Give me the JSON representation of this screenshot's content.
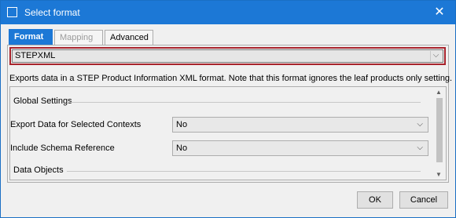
{
  "window": {
    "title": "Select format",
    "close_glyph": "✕"
  },
  "tabs": [
    {
      "label": "Format",
      "active": true
    },
    {
      "label": "Mapping",
      "active": false,
      "disabled": true
    },
    {
      "label": "Advanced",
      "active": false
    }
  ],
  "format_select": {
    "value": "STEPXML",
    "chevron": "⌵"
  },
  "description": "Exports data in a STEP Product Information XML format. Note that this format ignores the leaf products only setting.",
  "settings": {
    "global_heading": "Global Settings",
    "rows": [
      {
        "label": "Export Data for Selected Contexts",
        "value": "No"
      },
      {
        "label": "Include Schema Reference",
        "value": "No"
      }
    ],
    "data_objects_heading": "Data Objects"
  },
  "scroll": {
    "up": "▲",
    "down": "▼"
  },
  "icons": {
    "chevron": "⌵"
  },
  "buttons": {
    "ok": "OK",
    "cancel": "Cancel"
  },
  "colors": {
    "accent": "#1c78d6",
    "highlight_border": "#a8232c"
  }
}
